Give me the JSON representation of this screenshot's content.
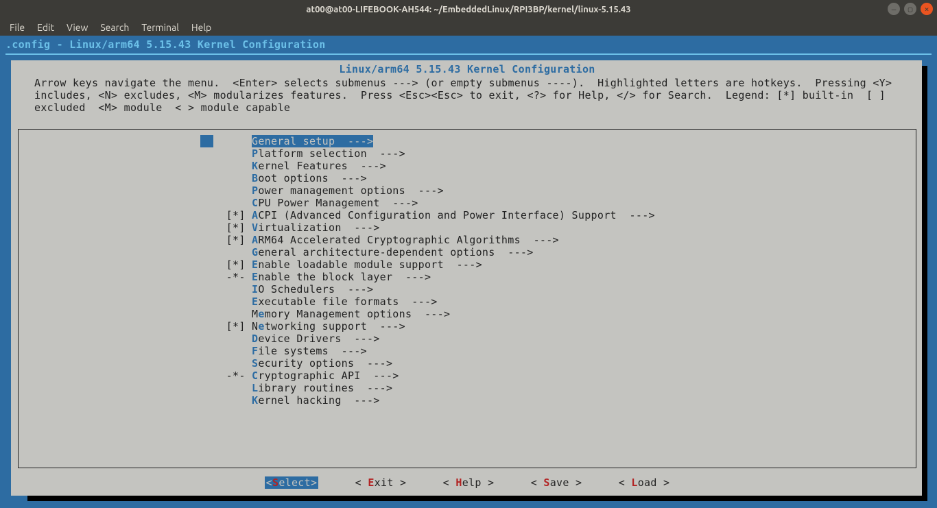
{
  "window": {
    "title": "at00@at00-LIFEBOOK-AH544: ~/EmbeddedLinux/RPI3BP/kernel/linux-5.15.43"
  },
  "menubar": {
    "file": "File",
    "edit": "Edit",
    "view": "View",
    "search": "Search",
    "terminal": "Terminal",
    "help": "Help"
  },
  "config_header": ".config - Linux/arm64 5.15.43 Kernel Configuration",
  "panel_title": "Linux/arm64 5.15.43 Kernel Configuration",
  "help_text": "Arrow keys navigate the menu.  <Enter> selects submenus ---> (or empty submenus ----).  Highlighted letters are hotkeys.  Pressing <Y> includes, <N> excludes, <M> modularizes features.  Press <Esc><Esc> to exit, <?> for Help, </> for Search.  Legend: [*] built-in  [ ] excluded  <M> module  < > module capable",
  "items": [
    {
      "state": "   ",
      "hot": "G",
      "rest": "eneral setup  --->",
      "selected": true
    },
    {
      "state": "   ",
      "hot": "P",
      "rest": "latform selection  --->"
    },
    {
      "state": "   ",
      "hot": "K",
      "rest": "ernel Features  --->"
    },
    {
      "state": "   ",
      "hot": "B",
      "rest": "oot options  --->"
    },
    {
      "state": "   ",
      "hot": "P",
      "rest": "ower management options  --->"
    },
    {
      "state": "   ",
      "hot": "C",
      "rest": "PU Power Management  --->"
    },
    {
      "state": "[*]",
      "hot": "A",
      "rest": "CPI (Advanced Configuration and Power Interface) Support  --->"
    },
    {
      "state": "[*]",
      "hot": "V",
      "rest": "irtualization  --->"
    },
    {
      "state": "[*]",
      "hot": "A",
      "rest": "RM64 Accelerated Cryptographic Algorithms  --->"
    },
    {
      "state": "   ",
      "hot": "G",
      "rest": "eneral architecture-dependent options  --->"
    },
    {
      "state": "[*]",
      "hot": "E",
      "rest": "nable loadable module support  --->"
    },
    {
      "state": "-*-",
      "hot": "E",
      "rest": "nable the block layer  --->"
    },
    {
      "state": "   ",
      "hot": "I",
      "rest": "O Schedulers  --->"
    },
    {
      "state": "   ",
      "hot": "E",
      "rest": "xecutable file formats  --->"
    },
    {
      "state": "   ",
      "pre": "M",
      "hot": "e",
      "rest": "mory Management options  --->"
    },
    {
      "state": "[*]",
      "pre": "N",
      "hot": "e",
      "rest": "tworking support  --->"
    },
    {
      "state": "   ",
      "hot": "D",
      "rest": "evice Drivers  --->"
    },
    {
      "state": "   ",
      "hot": "F",
      "rest": "ile systems  --->"
    },
    {
      "state": "   ",
      "hot": "S",
      "rest": "ecurity options  --->"
    },
    {
      "state": "-*-",
      "hot": "C",
      "rest": "ryptographic API  --->"
    },
    {
      "state": "   ",
      "hot": "L",
      "rest": "ibrary routines  --->"
    },
    {
      "state": "   ",
      "hot": "K",
      "rest": "ernel hacking  --->"
    }
  ],
  "buttons": {
    "select": {
      "open": "<",
      "hot": "S",
      "rest": "elect>",
      "selected": true
    },
    "exit": {
      "open": "< ",
      "hot": "E",
      "rest": "xit >"
    },
    "help": {
      "open": "< ",
      "hot": "H",
      "rest": "elp >"
    },
    "save": {
      "open": "< ",
      "hot": "S",
      "rest": "ave >"
    },
    "load": {
      "open": "< ",
      "hot": "L",
      "rest": "oad >"
    }
  }
}
